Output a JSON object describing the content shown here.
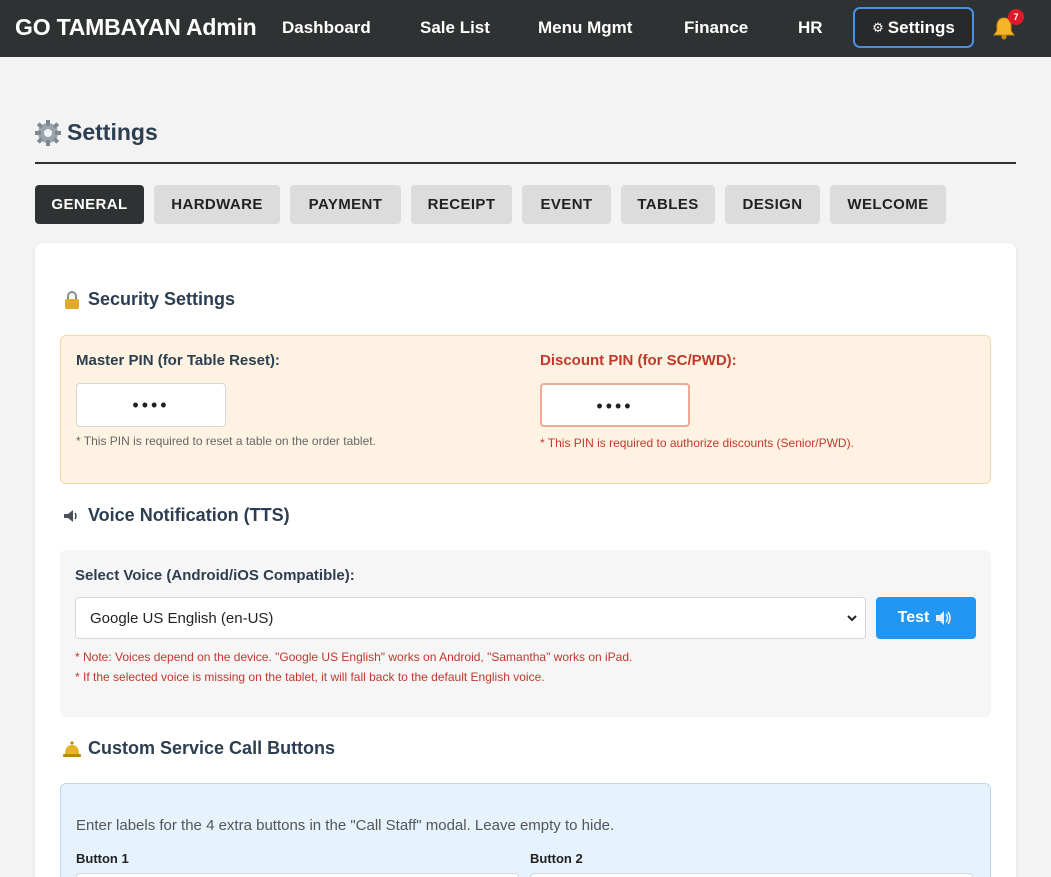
{
  "app": {
    "title": "GO TAMBAYAN Admin"
  },
  "nav": {
    "links": [
      "Dashboard",
      "Sale List",
      "Menu Mgmt",
      "Finance",
      "HR"
    ],
    "settings": {
      "icon": "gear-icon",
      "label": "Settings"
    },
    "notifications": {
      "icon": "bell-icon",
      "count": "7"
    }
  },
  "page": {
    "title": "Settings",
    "icon": "gear-icon"
  },
  "tabs": [
    "GENERAL",
    "HARDWARE",
    "PAYMENT",
    "RECEIPT",
    "EVENT",
    "TABLES",
    "DESIGN",
    "WELCOME"
  ],
  "active_tab": "GENERAL",
  "security": {
    "heading": "Security Settings",
    "icon": "lock-icon",
    "master_pin": {
      "label": "Master PIN (for Table Reset):",
      "value": "••••",
      "note": "* This PIN is required to reset a table on the order tablet."
    },
    "discount_pin": {
      "label": "Discount PIN (for SC/PWD):",
      "value": "••••",
      "note": "* This PIN is required to authorize discounts (Senior/PWD)."
    }
  },
  "voice": {
    "heading": "Voice Notification (TTS)",
    "icon": "speaker-icon",
    "select_label": "Select Voice (Android/iOS Compatible):",
    "selected": "Google US English (en-US)",
    "test_button": "Test",
    "note1": "* Note: Voices depend on the device. \"Google US English\" works on Android, \"Samantha\" works on iPad.",
    "note2": "* If the selected voice is missing on the tablet, it will fall back to the default English voice."
  },
  "call_buttons": {
    "heading": "Custom Service Call Buttons",
    "icon": "service-bell-icon",
    "description": "Enter labels for the 4 extra buttons in the \"Call Staff\" modal. Leave empty to hide.",
    "button1_label": "Button 1",
    "button2_label": "Button 2"
  },
  "colors": {
    "topbar": "#2f3233",
    "accent": "#2196f3",
    "danger": "#c0392b",
    "security_bg": "#fef3e2",
    "call_bg": "#e6f2fc"
  }
}
